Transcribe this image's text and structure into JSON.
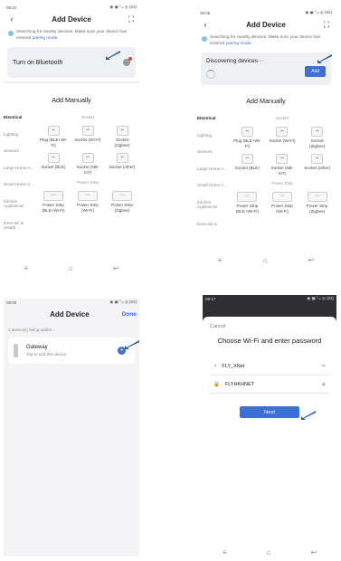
{
  "panel1": {
    "status_time": "08:24",
    "status_icons": "◉ ▣ ᵀ₄ₗ ◎ (83)",
    "title": "Add Device",
    "search_note": "Searching for nearby devices. Make sure your device has entered",
    "pairing_link": "pairing mode.",
    "bluetooth_label": "Turn on Bluetooth",
    "add_manually": "Add Manually",
    "categories": [
      "Electrical",
      "Lighting",
      "Sensors",
      "Large Home A…",
      "Small Home A…",
      "Kitchen Appliances",
      "Exercise & Health"
    ],
    "socket_header": "Socket",
    "power_strip_header": "Power Strip",
    "row1": [
      "Plug (BLE+Wi-Fi)",
      "Socket (Wi-Fi)",
      "Socket (Zigbee)"
    ],
    "row2": [
      "Socket (BLE)",
      "Socket (NB-IoT)",
      "Socket (other)"
    ],
    "row3": [
      "Power Strip (BLE+Wi-Fi)",
      "Power Strip (Wi-Fi)",
      "Power Strip (Zigbee)"
    ]
  },
  "panel2": {
    "status_time": "08:05",
    "status_icons": "◉ ▣ ᵀ₄ₗ ◎ (83)",
    "title": "Add Device",
    "search_note": "Searching for nearby devices. Make sure your device has entered",
    "pairing_link": "pairing mode.",
    "discovering": "Discovering devices···",
    "add_button": "Add",
    "add_manually": "Add Manually",
    "categories": [
      "Electrical",
      "Lighting",
      "Sensors",
      "Large Home A…",
      "Small Home A…",
      "Kitchen Appliances",
      "Exercise &"
    ],
    "socket_header": "Socket",
    "power_strip_header": "Power Strip",
    "row1": [
      "Plug (BLE+Wi-Fi)",
      "Socket (Wi-Fi)",
      "Socket (Zigbee)"
    ],
    "row2": [
      "Socket (BLE)",
      "Socket (NB-IoT)",
      "Socket (other)"
    ],
    "row3": [
      "Power Strip (BLE+Wi-Fi)",
      "Power Strip (Wi-Fi)",
      "Power Strip (Zigbee)"
    ]
  },
  "panel3": {
    "status_time": "08:08",
    "status_icons": "◉ ▣ ᵀ₄ₗ ◎ (83)",
    "title": "Add Device",
    "done": "Done",
    "added_note": "1 device(s) being added",
    "gateway_name": "Gateway",
    "gateway_sub": "Tap to add this device"
  },
  "panel4": {
    "status_time": "08:17",
    "status_icons": "◉ ▣ ᵀ₄ₗ ◎ (83)",
    "cancel": "Cancel",
    "title": "Choose Wi-Fi and enter password",
    "wifi_name": "FLY_XNet",
    "password": "FLYHKHNET",
    "next": "Next"
  },
  "colors": {
    "accent": "#3d6fd8",
    "arrow": "#2a5a9a"
  },
  "icons": {
    "back": "chevron-left-icon",
    "scan": "scan-icon",
    "home": "home-nav-icon",
    "back_nav": "back-nav-icon",
    "menu": "menu-nav-icon"
  }
}
